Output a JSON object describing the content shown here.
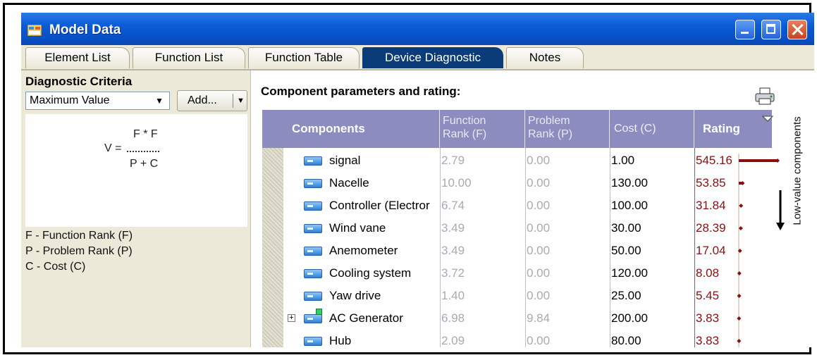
{
  "window": {
    "title": "Model Data"
  },
  "tabs": [
    {
      "label": "Element List",
      "active": false
    },
    {
      "label": "Function List",
      "active": false
    },
    {
      "label": "Function Table",
      "active": false
    },
    {
      "label": "Device Diagnostic",
      "active": true
    },
    {
      "label": "Notes",
      "active": false
    }
  ],
  "criteria": {
    "title": "Diagnostic Criteria",
    "selected": "Maximum Value",
    "add_label": "Add...",
    "formula": {
      "lhs": "V =",
      "numerator": "F * F",
      "denominator": "P + C"
    },
    "legend": [
      "F - Function Rank (F)",
      "P - Problem Rank (P)",
      "C - Cost (C)"
    ]
  },
  "table": {
    "title": "Component parameters and rating:",
    "headers": {
      "components": "Components",
      "function_rank": [
        "Function",
        "Rank (F)"
      ],
      "problem_rank": [
        "Problem",
        "Rank (P)"
      ],
      "cost": "Cost (C)",
      "rating": "Rating"
    },
    "rows": [
      {
        "name": "signal",
        "f": "2.79",
        "p": "0.00",
        "c": "1.00",
        "r": "545.16",
        "expand": false
      },
      {
        "name": "Nacelle",
        "f": "10.00",
        "p": "0.00",
        "c": "130.00",
        "r": "53.85",
        "expand": false
      },
      {
        "name": "Controller (Electror",
        "f": "6.74",
        "p": "0.00",
        "c": "100.00",
        "r": "31.84",
        "expand": false
      },
      {
        "name": "Wind vane",
        "f": "3.49",
        "p": "0.00",
        "c": "30.00",
        "r": "28.39",
        "expand": false
      },
      {
        "name": "Anemometer",
        "f": "3.49",
        "p": "0.00",
        "c": "50.00",
        "r": "17.04",
        "expand": false
      },
      {
        "name": "Cooling system",
        "f": "3.72",
        "p": "0.00",
        "c": "120.00",
        "r": "8.08",
        "expand": false
      },
      {
        "name": "Yaw drive",
        "f": "1.40",
        "p": "0.00",
        "c": "25.00",
        "r": "5.45",
        "expand": false
      },
      {
        "name": "AC Generator",
        "f": "6.98",
        "p": "9.84",
        "c": "200.00",
        "r": "3.83",
        "expand": true
      },
      {
        "name": "Hub",
        "f": "2.09",
        "p": "0.00",
        "c": "80.00",
        "r": "3.83",
        "expand": false
      }
    ],
    "side_label": "Low-value components"
  },
  "colors": {
    "header": "#8c8cbf",
    "rating": "#8b0f0f",
    "title_bar": "#0a5bd6",
    "active_tab": "#0b3c7a"
  }
}
